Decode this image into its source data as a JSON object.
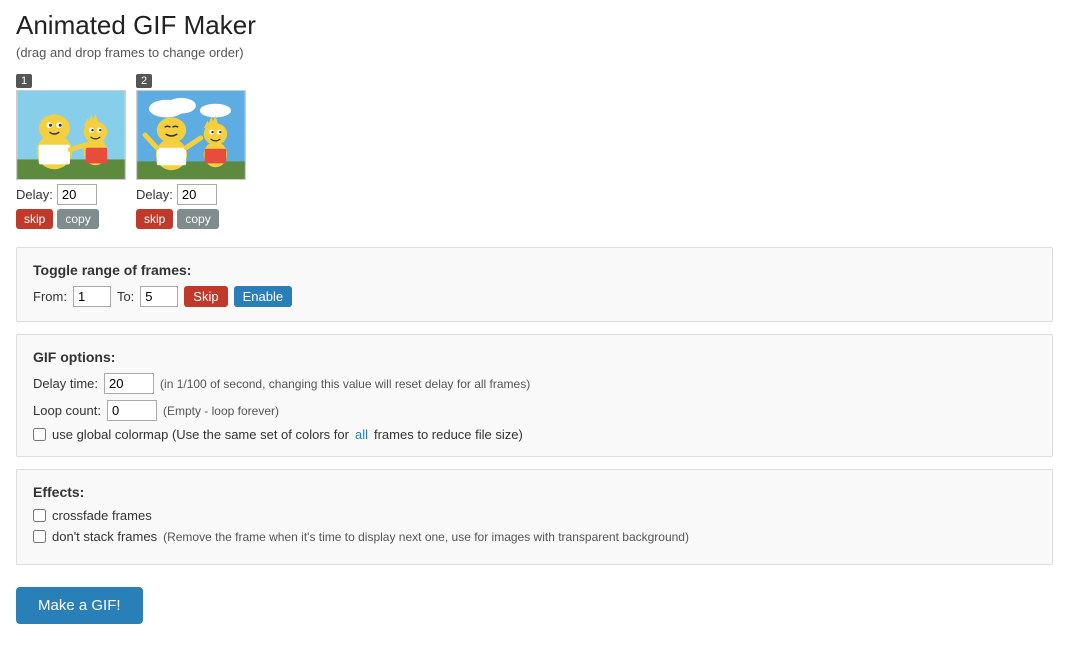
{
  "page": {
    "title": "Animated GIF Maker",
    "subtitle": "(drag and drop frames to change order)"
  },
  "frames": [
    {
      "number": "1",
      "delay_label": "Delay:",
      "delay_value": "20",
      "skip_label": "skip",
      "copy_label": "copy"
    },
    {
      "number": "2",
      "delay_label": "Delay:",
      "delay_value": "20",
      "skip_label": "skip",
      "copy_label": "copy"
    }
  ],
  "toggle_range": {
    "title": "Toggle range of frames:",
    "from_label": "From:",
    "from_value": "1",
    "to_label": "To:",
    "to_value": "5",
    "skip_label": "Skip",
    "enable_label": "Enable"
  },
  "gif_options": {
    "title": "GIF options:",
    "delay_time_label": "Delay time:",
    "delay_time_value": "20",
    "delay_time_note": "(in 1/100 of second, changing this value will reset delay for all frames)",
    "loop_count_label": "Loop count:",
    "loop_count_value": "0",
    "loop_count_note": "(Empty - loop forever)",
    "colormap_label": "use global colormap (Use the same set of colors for",
    "colormap_link": "all",
    "colormap_label2": "frames to reduce file size)"
  },
  "effects": {
    "title": "Effects:",
    "crossfade_label": "crossfade frames",
    "dont_stack_label": "don't stack frames",
    "dont_stack_note": "(Remove the frame when it's time to display next one, use for images with transparent background)"
  },
  "make_gif_button": "Make a GIF!"
}
